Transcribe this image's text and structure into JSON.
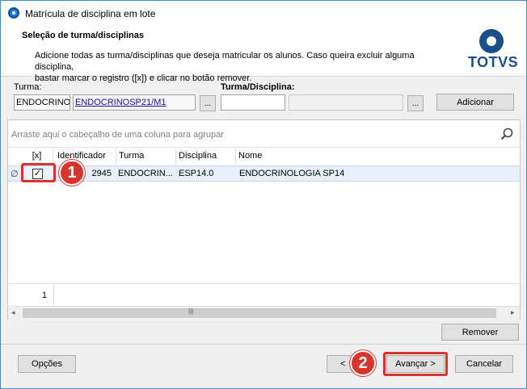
{
  "window": {
    "title": "Matrícula de disciplina em lote"
  },
  "header": {
    "title": "Seleção de turma/disciplinas",
    "description_line1": "Adicione todas as turma/disciplinas que deseja matricular os alunos. Caso queira excluir alguma disciplina,",
    "description_line2": "bastar marcar o registro ([x]) e clicar no botão remover.",
    "logo_text": "TOTVS"
  },
  "form": {
    "turma_label": "Turma:",
    "turma_code": "ENDOCRINO",
    "turma_value": "ENDOCRINOSP21/M1",
    "browse_label": "...",
    "turma_disciplina_label": "Turma/Disciplina:",
    "turma_disciplina_code": "",
    "turma_disciplina_value": "",
    "adicionar_label": "Adicionar"
  },
  "grid": {
    "group_hint": "Arraste aqui o cabeçalho de uma coluna para agrupar",
    "columns": [
      "[x]",
      "Identificador",
      "Turma",
      "Disciplina",
      "Nome"
    ],
    "rows": [
      {
        "checked": "✓",
        "identificador": "2945",
        "turma": "ENDOCRIN...",
        "disciplina": "ESP14.0",
        "nome": "ENDOCRINOLOGIA SP14"
      }
    ],
    "row_marker": "∅",
    "count": "1",
    "scroll_left": "◂",
    "scroll_right": "▸",
    "scroll_grip": "|||"
  },
  "buttons": {
    "remover": "Remover",
    "opcoes": "Opções",
    "voltar": "<",
    "avancar": "Avançar >",
    "cancelar": "Cancelar"
  },
  "callouts": [
    "1",
    "2"
  ],
  "colors": {
    "callout": "#d9342b",
    "accent": "#1a4f8c"
  }
}
